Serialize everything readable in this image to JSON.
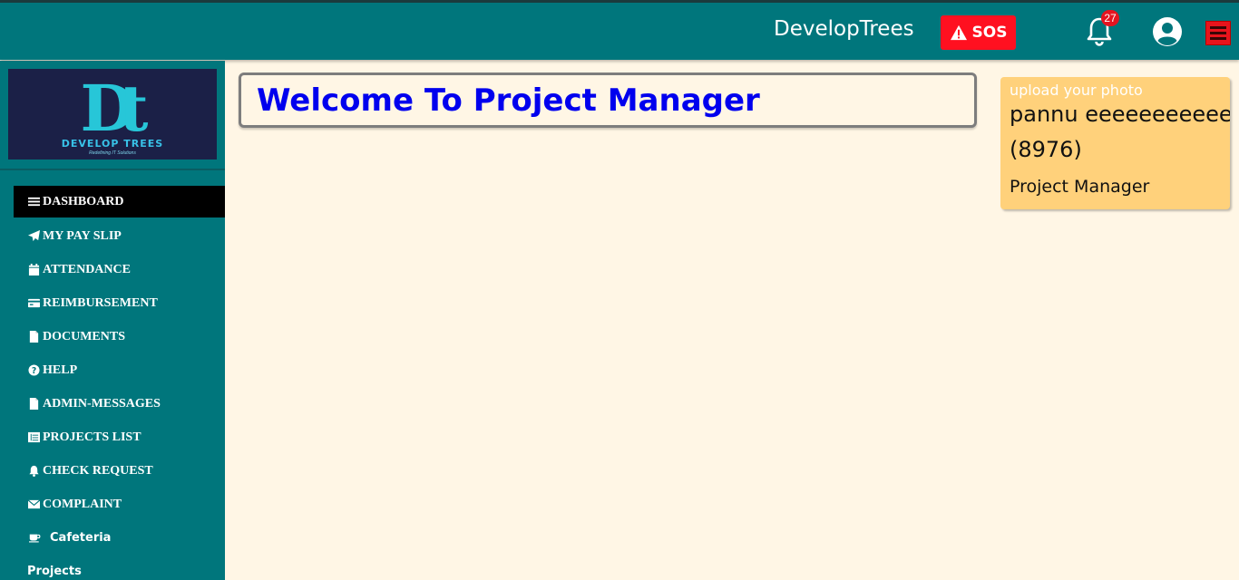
{
  "header": {
    "brand": "DevelopTrees",
    "sos_label": "SOS",
    "notification_count": "27",
    "colors": {
      "bar": "#00767c",
      "sos": "#ff1020",
      "badge": "#e41420"
    }
  },
  "sidebar": {
    "logo": {
      "text": "DEVELOP TREES",
      "tagline": "Redefining IT Solutions",
      "mark": "Dt"
    },
    "items": [
      {
        "label": "DASHBOARD",
        "icon": "bars-icon",
        "active": true
      },
      {
        "label": "MY PAY SLIP",
        "icon": "paper-plane-icon"
      },
      {
        "label": "ATTENDANCE",
        "icon": "calendar-icon"
      },
      {
        "label": "REIMBURSEMENT",
        "icon": "credit-card-icon"
      },
      {
        "label": "DOCUMENTS",
        "icon": "file-icon"
      },
      {
        "label": "HELP",
        "icon": "question-circle-icon"
      },
      {
        "label": "ADMIN-MESSAGES",
        "icon": "file-icon"
      },
      {
        "label": "PROJECTS LIST",
        "icon": "list-icon"
      },
      {
        "label": "CHECK REQUEST",
        "icon": "bell-icon"
      },
      {
        "label": "COMPLAINT",
        "icon": "envelope-icon"
      },
      {
        "label": "Cafeteria",
        "icon": "coffee-icon"
      },
      {
        "label": "Projects",
        "icon": ""
      }
    ]
  },
  "main": {
    "welcome_title": "Welcome To Project Manager"
  },
  "profile_card": {
    "upload_label": "upload your photo",
    "name": "pannu eeeeeeeeeeee",
    "employee_id": "(8976)",
    "role": "Project Manager"
  }
}
